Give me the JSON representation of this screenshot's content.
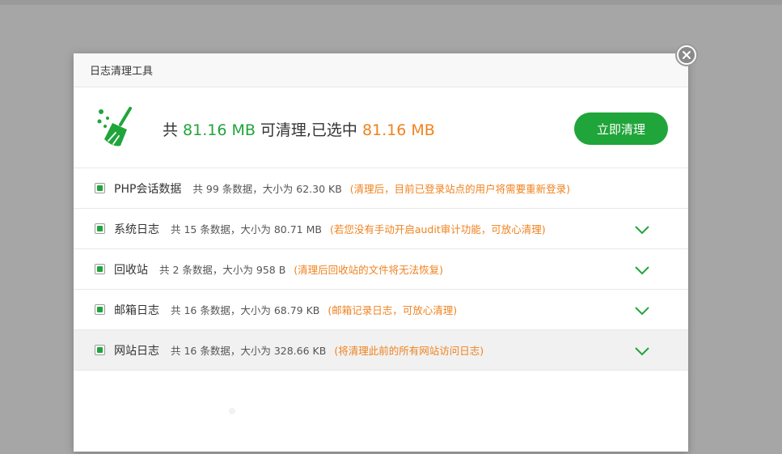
{
  "dialog": {
    "title": "日志清理工具",
    "summary": {
      "prefix": "共",
      "total": "81.16 MB",
      "middle": "可清理,已选中",
      "selected": "81.16 MB"
    },
    "clean_button_label": "立即清理"
  },
  "rows": [
    {
      "name": "PHP会话数据",
      "info": "共 99 条数据，大小为 62.30 KB",
      "note": "(清理后，目前已登录站点的用户将需要重新登录)",
      "checked": true,
      "expandable": false
    },
    {
      "name": "系统日志",
      "info": "共 15 条数据，大小为 80.71 MB",
      "note": "(若您没有手动开启audit审计功能，可放心清理)",
      "checked": true,
      "expandable": true
    },
    {
      "name": "回收站",
      "info": "共 2 条数据，大小为 958 B",
      "note": "(清理后回收站的文件将无法恢复)",
      "checked": true,
      "expandable": true
    },
    {
      "name": "邮箱日志",
      "info": "共 16 条数据，大小为 68.79 KB",
      "note": "(邮箱记录日志，可放心清理)",
      "checked": true,
      "expandable": true
    },
    {
      "name": "网站日志",
      "info": "共 16 条数据，大小为 328.66 KB",
      "note": "(将清理此前的所有网站访问日志)",
      "checked": true,
      "expandable": true
    }
  ],
  "colors": {
    "accent_green": "#20a53a",
    "note_orange": "#f0821e",
    "overlay_gray": "#a6a6a6"
  },
  "icons": [
    "broom-icon",
    "close-icon",
    "chevron-down-icon"
  ]
}
